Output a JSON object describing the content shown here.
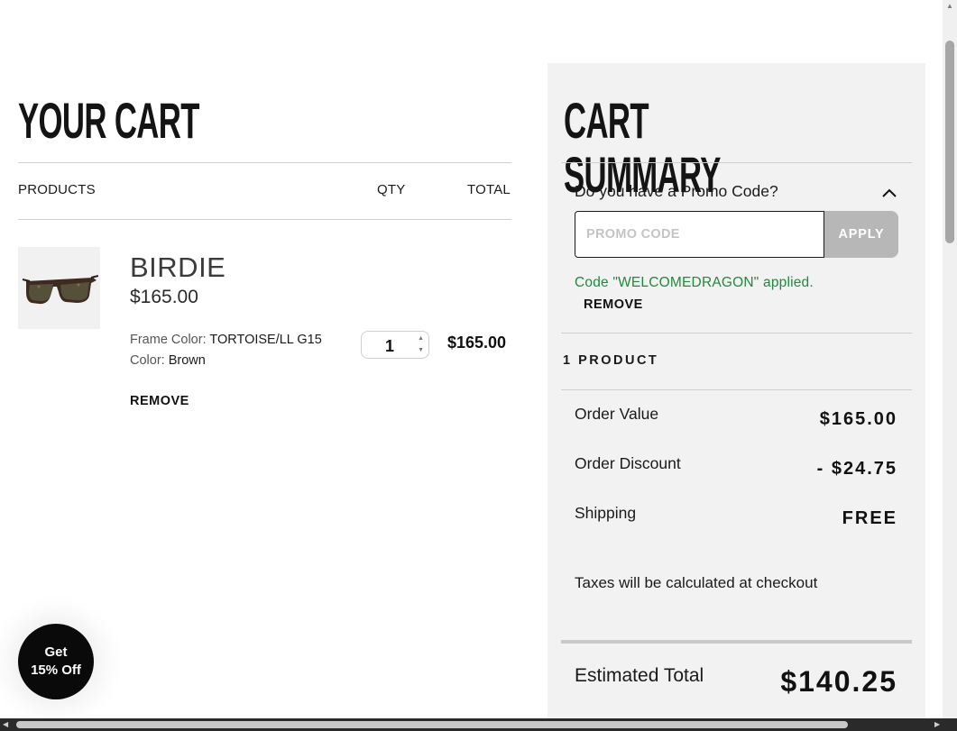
{
  "cart": {
    "title": "YOUR CART",
    "columns": {
      "products": "PRODUCTS",
      "qty": "QTY",
      "total": "TOTAL"
    },
    "item": {
      "name": "BIRDIE",
      "price": "$165.00",
      "frame_color_label": "Frame Color:",
      "frame_color_value": "TORTOISE/LL G15",
      "color_label": "Color:",
      "color_value": "Brown",
      "quantity": "1",
      "line_total": "$165.00",
      "remove_label": "REMOVE"
    }
  },
  "summary": {
    "title": "CART SUMMARY",
    "promo_question": "Do you have a Promo Code?",
    "promo_placeholder": "PROMO CODE",
    "apply_label": "APPLY",
    "applied_message": "Code \"WELCOMEDRAGON\" applied.",
    "remove_promo_label": "REMOVE",
    "product_count": "1 PRODUCT",
    "rows": [
      {
        "label": "Order Value",
        "value": "$165.00"
      },
      {
        "label": "Order Discount",
        "value": "- $24.75"
      },
      {
        "label": "Shipping",
        "value": "FREE"
      }
    ],
    "tax_note": "Taxes will be calculated at checkout",
    "estimated_total_label": "Estimated Total",
    "estimated_total_value": "$140.25"
  },
  "promo_badge": {
    "line1": "Get",
    "line2": "15% Off"
  },
  "colors": {
    "applied_green": "#1f8a3a",
    "panel_bg": "#f2f2f2",
    "apply_button": "#b7b7b7"
  },
  "icons": [
    "chevron-up-icon",
    "sunglasses-image",
    "spinner-up-icon",
    "spinner-down-icon"
  ]
}
